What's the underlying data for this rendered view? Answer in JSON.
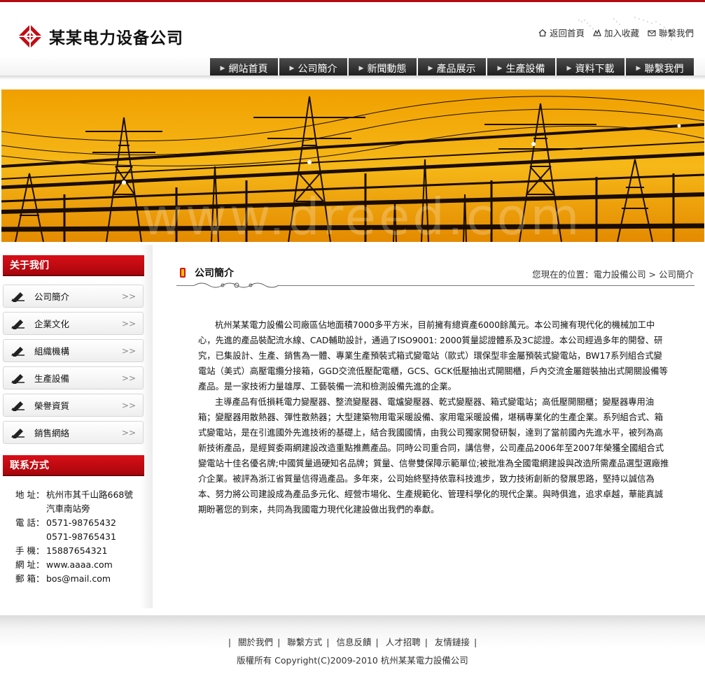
{
  "brand": {
    "name": "某某电力设备公司",
    "accent": "#c40c13"
  },
  "top_links": [
    {
      "label": "返回首頁",
      "icon": "home-icon"
    },
    {
      "label": "加入收藏",
      "icon": "bookmark-icon"
    },
    {
      "label": "聯繫我們",
      "icon": "mail-icon"
    }
  ],
  "nav": [
    "網站首頁",
    "公司簡介",
    "新聞動態",
    "產品展示",
    "生產設備",
    "資料下載",
    "聯繫我們"
  ],
  "banner": {
    "watermark": "www.dreed.com"
  },
  "sidebar": {
    "about_title": "关于我们",
    "items": [
      "公司簡介",
      "企業文化",
      "組織機構",
      "生產設備",
      "榮譽資質",
      "銷售網絡"
    ],
    "contact_title": "联系方式",
    "contact": {
      "address_label": "地 址：",
      "address_1": "杭州市其千山路668號",
      "address_2": "汽車南站旁",
      "phone_label": "電 話：",
      "phone_1": "0571-98765432",
      "phone_2": "0571-98765431",
      "mobile_label": "手 機：",
      "mobile": "15887654321",
      "web_label": "網 址：",
      "web": "www.aaaa.com",
      "email_label": "郵 箱：",
      "email": "bos@mail.com"
    }
  },
  "content": {
    "title": "公司簡介",
    "breadcrumb": "您現在的位置：電力設備公司 > 公司簡介",
    "paragraphs": [
      "杭州某某電力設備公司廠區佔地面積7000多平方米，目前擁有總資產6000餘萬元。本公司擁有現代化的機械加工中心，先進的產品裝配流水線、CAD輔助設計，通過了ISO9001: 2000質量認證體系及3C認證。本公司經過多年的開發、研究，已集設計、生產、銷售為一體、專業生產預裝式箱式變電站（歐式）環保型非金屬預裝式變電站，BW17系列組合式變電站（美式）高壓電纜分接箱，GGD交流低壓配電櫃，GCS、GCK低壓抽出式開關櫃，戶內交流金屬鎧裝抽出式開關設備等產品。是一家技術力量雄厚、工藝裝備一流和檢測設備先進的企業。",
      "主導產品有低損耗電力變壓器、整流變壓器、電爐變壓器、乾式變壓器、箱式變電站；高低壓開關櫃；變壓器專用油箱；變壓器用散熱器、彈性散熱器；大型建築物用電采暖設備、家用電采暖設備，堪稱專業化的生產企業。系列組合式、箱式變電站，是在引進國外先進技術的基礎上，結合我國國情，由我公司獨家開發研製，達到了當前國內先進水平，被列為高新技術產品，是經貿委兩網建設改造重點推薦產品。同時公司重合同，講信譽，公司產品2006年至2007年榮獲全國組合式變電站十佳名優名牌;中國質量過硬知名品牌；質量、信譽雙保障示範單位;被批准為全國電網建設與改造所需產品選型選廠推介企業。被評為浙江省質量信得過產品。多年來，公司始終堅持依靠科技進步，致力技術創新的發展思路，堅持以誠信為本、努力將公司建設成為產品多元化、經營市場化、生產規範化、管理科學化的現代企業。與時俱進，追求卓越，華能真誠期盼著您的到來，共同為我國電力現代化建設做出我們的奉獻。"
    ]
  },
  "footer": {
    "links": [
      "關於我們",
      "聯繫方式",
      "信息反饋",
      "人才招聘",
      "友情鏈接"
    ],
    "copyright": "版權所有 Copyright(C)2009-2010 杭州某某電力設備公司"
  }
}
